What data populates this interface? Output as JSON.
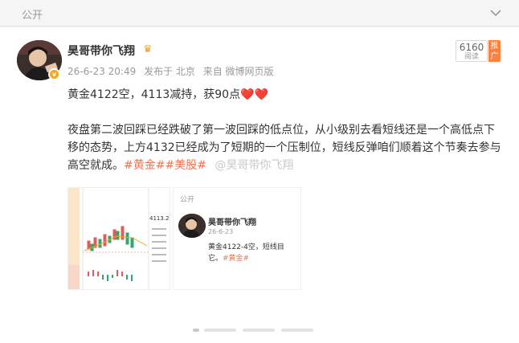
{
  "topbar": {
    "label": "公开"
  },
  "post": {
    "author": "昊哥带你飞翔",
    "timestamp": "26-6-23 20:49",
    "location": "发布于 北京",
    "source": "来自 微博网页版",
    "reads": {
      "count": "6160",
      "label": "阅读"
    },
    "promote_label": "推广",
    "line1": "黄金4122空，4113减持，获90点",
    "body": "夜盘第二波回踩已经跌破了第一波回踩的低点位，从小级别去看短线还是一个高低点下移的态势，上方4132已经成为了短期的一个压制位，短线反弹咱们顺着这个节奏去参与高空就成。",
    "tags": [
      "#黄金#",
      "#美股#"
    ],
    "watermark": "@昊哥带你飞翔"
  },
  "thumb2": {
    "label": "公开",
    "author": "昊哥带你飞翔",
    "timestamp": "26-6-23",
    "line": "黄金4122-4空，短线目",
    "line2": "它。",
    "tag": "#黄金#"
  },
  "thumb1": {
    "price_text": "4113.2"
  },
  "colors": {
    "accent": "#eb7350",
    "promote": "#ff8140",
    "verified": "#f7a71e"
  },
  "icons": [
    "chevron-down-icon",
    "crown-icon",
    "verified-icon",
    "heart-icon"
  ]
}
